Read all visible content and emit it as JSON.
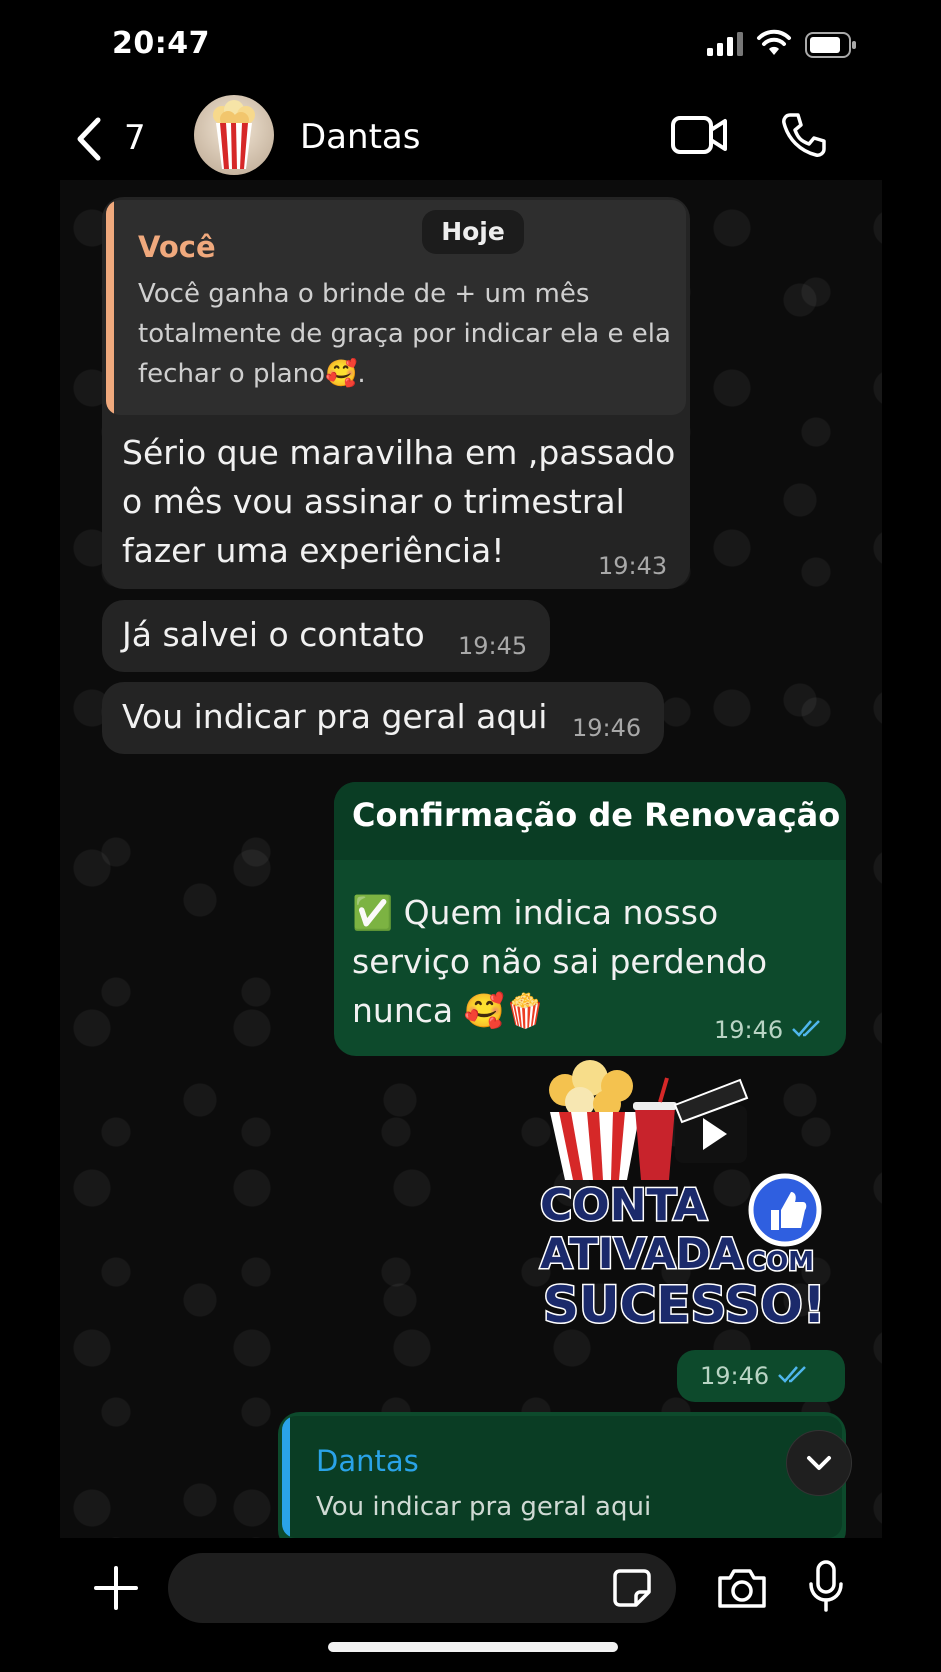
{
  "status_bar": {
    "time": "20:47"
  },
  "header": {
    "unread_count": "7",
    "contact_name": "Dantas"
  },
  "date_label": "Hoje",
  "messages": [
    {
      "quote": {
        "author": "Você",
        "text_lines": [
          "Você ganha o brinde de + um mês",
          "totalmente de graça por indicar ela e ela",
          "fechar o plano🥰."
        ]
      },
      "lines": [
        "Sério que maravilha em ,passado",
        "o mês vou assinar o trimestral",
        "fazer uma experiência!"
      ],
      "time": "19:43"
    },
    {
      "text": "Já salvei o contato",
      "time": "19:45"
    },
    {
      "text": "Vou indicar pra geral aqui",
      "time": "19:46"
    },
    {
      "title": "Confirmação de Renovação",
      "lines": [
        "✅ Quem indica nosso",
        "serviço não sai perdendo",
        "nunca 🥰🍿"
      ],
      "time": "19:46"
    },
    {
      "sticker_lines": [
        "CONTA",
        "ATIVADA",
        "COM",
        "SUCESSO!"
      ],
      "time": "19:46"
    },
    {
      "quote": {
        "author": "Dantas",
        "text": "Vou indicar pra geral aqui"
      }
    }
  ],
  "colors": {
    "incoming_bubble": "#242424",
    "outgoing_bubble": "#0d4a2c",
    "quote_accent_you": "#f0a97d",
    "quote_accent_contact": "#2aa3e8",
    "read_ticks": "#4fb6ec"
  }
}
